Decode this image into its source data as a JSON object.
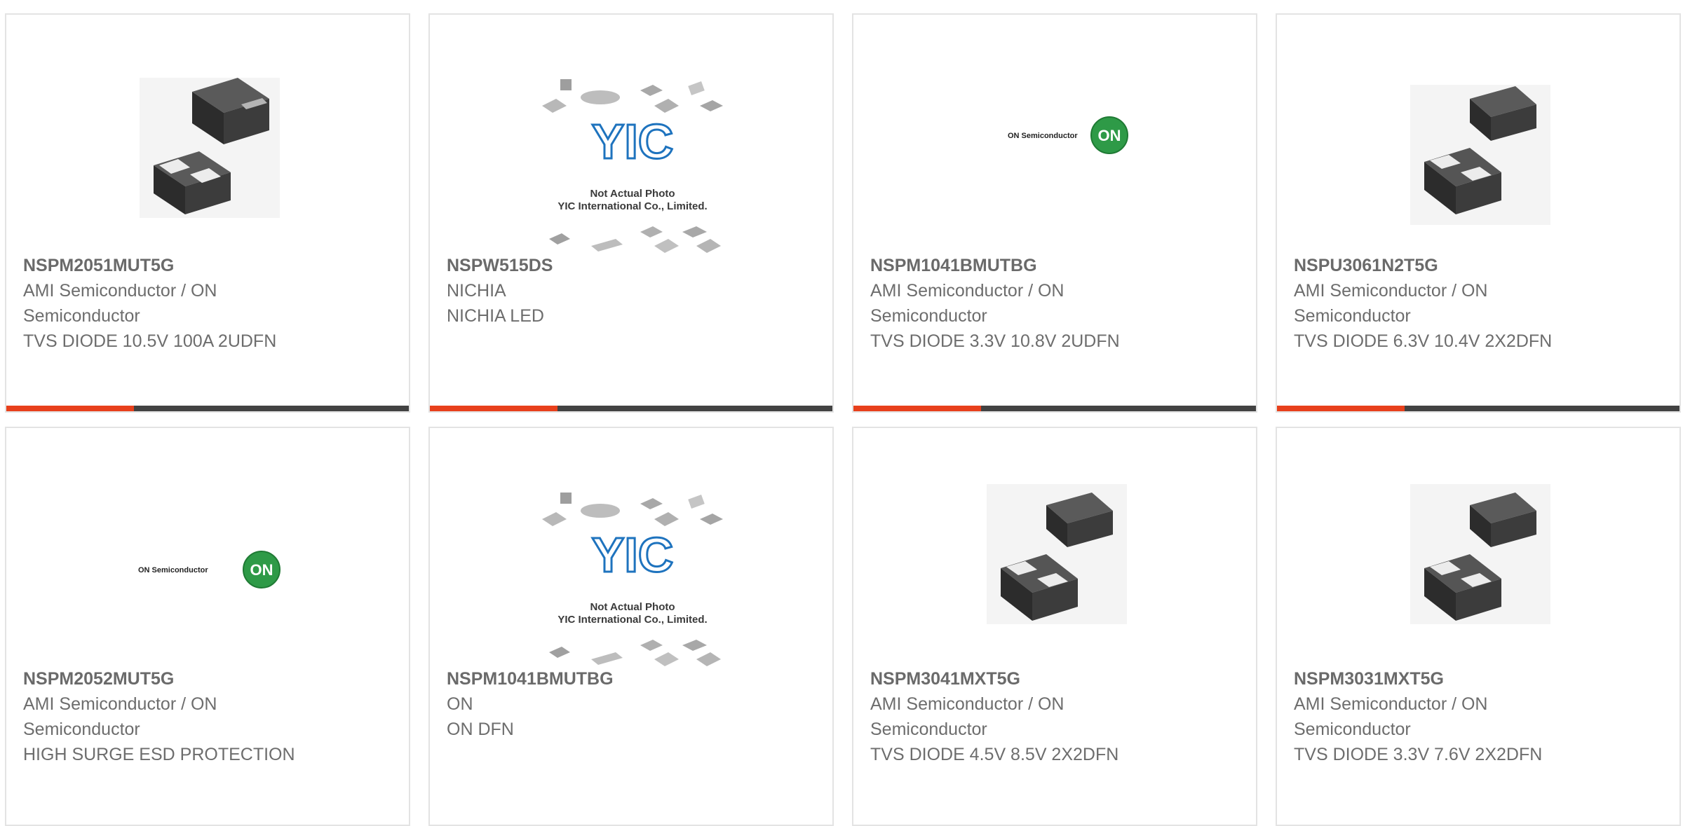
{
  "theme": {
    "accent": "#e8401c",
    "bar_dark": "#424242",
    "border": "#e3e3e3",
    "text": "#6d6d6d"
  },
  "products": [
    {
      "part_number": "NSPM2051MUT5G",
      "manufacturer": "AMI Semiconductor / ON Semiconductor",
      "description": "TVS DIODE 10.5V 100A 2UDFN",
      "image": "dfn-2pin-package",
      "accent_bar": true
    },
    {
      "part_number": "NSPW515DS",
      "manufacturer": "NICHIA",
      "description": "NICHIA LED",
      "image": "yic-placeholder",
      "placeholder_line1": "Not Actual Photo",
      "placeholder_line2": "YIC International Co., Limited.",
      "placeholder_logo": "YIC",
      "accent_bar": true
    },
    {
      "part_number": "NSPM1041BMUTBG",
      "manufacturer": "AMI Semiconductor / ON Semiconductor",
      "description": "TVS DIODE 3.3V 10.8V 2UDFN",
      "image": "on-semiconductor-logo",
      "logo_text": "ON Semiconductor",
      "logo_badge": "ON",
      "accent_bar": true
    },
    {
      "part_number": "NSPU3061N2T5G",
      "manufacturer": "AMI Semiconductor / ON Semiconductor",
      "description": "TVS DIODE 6.3V 10.4V 2X2DFN",
      "image": "dfn-2x2-package",
      "accent_bar": true
    },
    {
      "part_number": "NSPM2052MUT5G",
      "manufacturer": "AMI Semiconductor / ON Semiconductor",
      "description": "HIGH SURGE ESD PROTECTION",
      "image": "on-semiconductor-logo",
      "logo_text": "ON Semiconductor",
      "logo_badge": "ON",
      "accent_bar": false
    },
    {
      "part_number": "NSPM1041BMUTBG",
      "manufacturer": "ON",
      "description": "ON DFN",
      "image": "yic-placeholder",
      "placeholder_line1": "Not Actual Photo",
      "placeholder_line2": "YIC International Co., Limited.",
      "placeholder_logo": "YIC",
      "accent_bar": false
    },
    {
      "part_number": "NSPM3041MXT5G",
      "manufacturer": "AMI Semiconductor / ON Semiconductor",
      "description": "TVS DIODE 4.5V 8.5V 2X2DFN",
      "image": "dfn-2x2-package",
      "accent_bar": false
    },
    {
      "part_number": "NSPM3031MXT5G",
      "manufacturer": "AMI Semiconductor / ON Semiconductor",
      "description": "TVS DIODE 3.3V 7.6V 2X2DFN",
      "image": "dfn-2x2-package",
      "accent_bar": false
    }
  ]
}
